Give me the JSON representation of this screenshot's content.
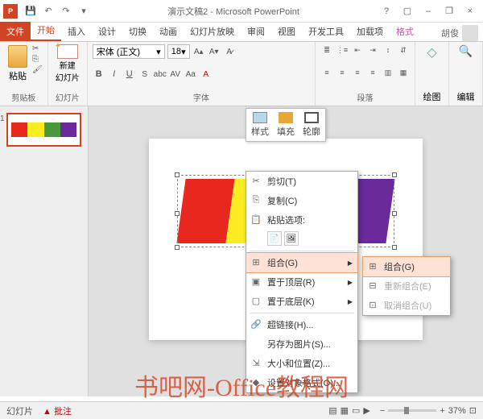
{
  "title": "演示文稿2 - Microsoft PowerPoint",
  "user": "胡俊",
  "tabs": {
    "file": "文件",
    "home": "开始",
    "insert": "插入",
    "design": "设计",
    "trans": "切换",
    "anim": "动画",
    "slideshow": "幻灯片放映",
    "review": "审阅",
    "view": "视图",
    "dev": "开发工具",
    "addin": "加载项",
    "format": "格式"
  },
  "ribbon": {
    "clipboard": {
      "paste": "粘贴",
      "label": "剪贴板"
    },
    "slides": {
      "new": "新建\n幻灯片",
      "label": "幻灯片"
    },
    "font": {
      "name": "宋体 (正文)",
      "size": "18",
      "label": "字体"
    },
    "para": {
      "label": "段落"
    },
    "draw": {
      "btn": "绘图",
      "label": ""
    },
    "edit": {
      "btn": "编辑",
      "label": ""
    }
  },
  "thumb_num": "1",
  "minitoolbar": {
    "style": "样式",
    "fill": "填充",
    "outline": "轮廓"
  },
  "context": {
    "cut": "剪切(T)",
    "copy": "复制(C)",
    "pasteopt": "粘贴选项:",
    "group": "组合(G)",
    "front": "置于顶层(R)",
    "back": "置于底层(K)",
    "link": "超链接(H)...",
    "savepic": "另存为图片(S)...",
    "size": "大小和位置(Z)...",
    "format": "设置对象格式(O)..."
  },
  "submenu": {
    "group": "组合(G)",
    "regroup": "重新组合(E)",
    "ungroup": "取消组合(U)"
  },
  "status": {
    "slide": "幻灯片",
    "approve": "批注",
    "zoom": "37%"
  },
  "watermark": "书吧网-Office教程网",
  "colors": {
    "red": "#e8281f",
    "yellow": "#fced22",
    "green": "#4a9a3c",
    "purple": "#6a2a9c"
  }
}
